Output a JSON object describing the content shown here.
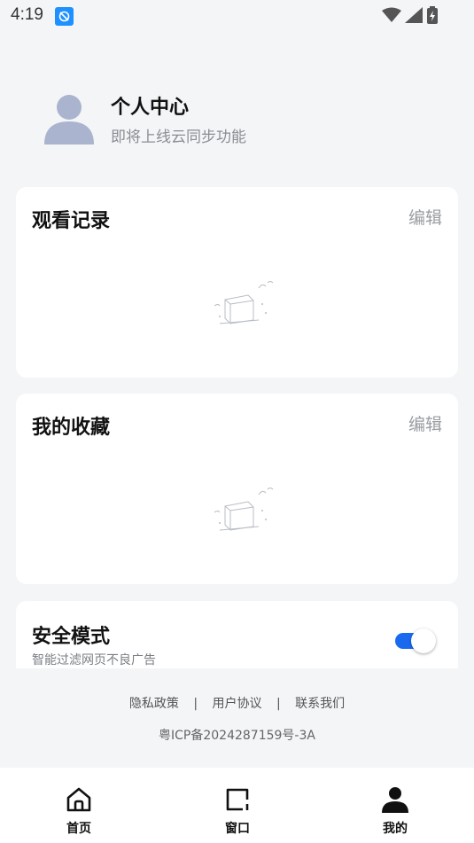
{
  "status": {
    "time": "4:19"
  },
  "profile": {
    "name": "个人中心",
    "subtitle": "即将上线云同步功能"
  },
  "history": {
    "title": "观看记录",
    "edit_label": "编辑"
  },
  "favorites": {
    "title": "我的收藏",
    "edit_label": "编辑"
  },
  "safe_mode": {
    "title": "安全模式",
    "subtitle": "智能过滤网页不良广告",
    "enabled": true
  },
  "footer": {
    "links": [
      "隐私政策",
      "用户协议",
      "联系我们"
    ],
    "separator": "|",
    "icp": "粤ICP备2024287159号-3A"
  },
  "tabs": [
    {
      "label": "首页",
      "icon": "home-icon"
    },
    {
      "label": "窗口",
      "icon": "window-icon"
    },
    {
      "label": "我的",
      "icon": "person-icon"
    }
  ],
  "colors": {
    "accent": "#1a6af0",
    "background": "#f4f5f7",
    "avatar": "#aab4cf"
  }
}
